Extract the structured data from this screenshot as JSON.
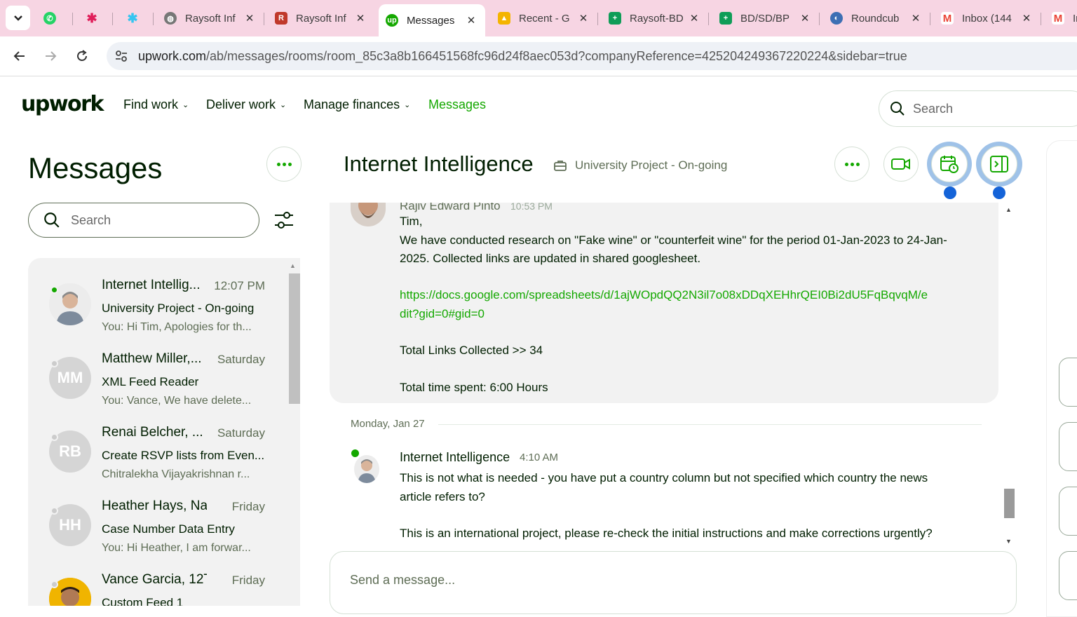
{
  "browser": {
    "tabs": [
      {
        "label": "",
        "icon": "whatsapp-icon",
        "color": "#25d366"
      },
      {
        "label": "",
        "icon": "slack-icon",
        "color": "#e01e5a"
      },
      {
        "label": "",
        "icon": "slack-icon",
        "color": "#e01e5a"
      },
      {
        "label": "Raysoft Inf",
        "icon": "globe-icon",
        "color": "#555555"
      },
      {
        "label": "Raysoft Inf",
        "icon": "raysoft-icon",
        "color": "#c0392b"
      },
      {
        "label": "Messages",
        "icon": "upwork-icon",
        "color": "#14a800",
        "active": true
      },
      {
        "label": "Recent - G",
        "icon": "google-drive-icon",
        "color": "#f4b400"
      },
      {
        "label": "Raysoft-BD",
        "icon": "google-sheets-icon",
        "color": "#0f9d58"
      },
      {
        "label": "BD/SD/BP",
        "icon": "google-sheets-icon",
        "color": "#0f9d58"
      },
      {
        "label": "Roundcub",
        "icon": "roundcube-icon",
        "color": "#3d6fb4"
      },
      {
        "label": "Inbox (144",
        "icon": "gmail-icon",
        "color": "#ea4335"
      },
      {
        "label": "In",
        "icon": "gmail-icon",
        "color": "#ea4335"
      }
    ],
    "url_host": "upwork.com",
    "url_path": "/ab/messages/rooms/room_85c3a8b166451568fc96d24f8aec053d?companyReference=425204249367220224&sidebar=true"
  },
  "header": {
    "logo": "upwork",
    "nav": [
      "Find work",
      "Deliver work",
      "Manage finances",
      "Messages"
    ],
    "search_placeholder": "Search"
  },
  "sidebar": {
    "title": "Messages",
    "search_placeholder": "Search",
    "conversations": [
      {
        "name": "Internet Intellig...",
        "time": "12:07 PM",
        "subject": "University Project - On-going",
        "preview": "You: Hi Tim, Apologies for th...",
        "initials": "",
        "online": true
      },
      {
        "name": "Matthew Miller,...",
        "time": "Saturday",
        "subject": "XML Feed Reader",
        "preview": "You: Vance, We have delete...",
        "initials": "MM",
        "online": false
      },
      {
        "name": "Renai Belcher, ...",
        "time": "Saturday",
        "subject": "Create RSVP lists from Even...",
        "preview": "Chitralekha Vijayakrishnan r...",
        "initials": "RB",
        "online": false
      },
      {
        "name": "Heather Hays, Na...",
        "time": "Friday",
        "subject": "Case Number Data Entry",
        "preview": "You: Hi Heather, I am forwar...",
        "initials": "HH",
        "online": false
      },
      {
        "name": "Vance Garcia, 12T...",
        "time": "Friday",
        "subject": "Custom Feed 1",
        "preview": "",
        "initials": "",
        "online": false
      }
    ]
  },
  "room": {
    "title": "Internet Intelligence",
    "project": "University Project - On-going",
    "message1": {
      "sender_partial": "Rajiv Edward Pinto",
      "time_partial": "10:53 PM",
      "line1": "Tim,",
      "line2": "We have conducted research on \"Fake wine\" or \"counterfeit wine\" for the period 01-Jan-2023 to 24-Jan-",
      "line3": "2025. Collected links are updated in shared googlesheet.",
      "link1": "https://docs.google.com/spreadsheets/d/1ajWOpdQQ2N3il7o08xDDqXEHhrQEI0Bi2dU5FqBqvqM/e",
      "link2": "dit?gid=0#gid=0",
      "total_links": "Total Links Collected >> 34",
      "total_time": "Total time spent: 6:00 Hours"
    },
    "date_separator": "Monday, Jan 27",
    "message2": {
      "sender": "Internet Intelligence",
      "time": "4:10 AM",
      "line1": "This is not what is needed - you have put a country column but not specified which country the news",
      "line2": "article refers to?",
      "line3": "This is an international project, please re-check the initial instructions and make corrections urgently?"
    },
    "composer_placeholder": "Send a message..."
  },
  "colors": {
    "brand_green": "#14a800",
    "tab_bar": "#f7d5e3",
    "active_button": "#9fc2e8",
    "notification_dot": "#1463d8"
  }
}
